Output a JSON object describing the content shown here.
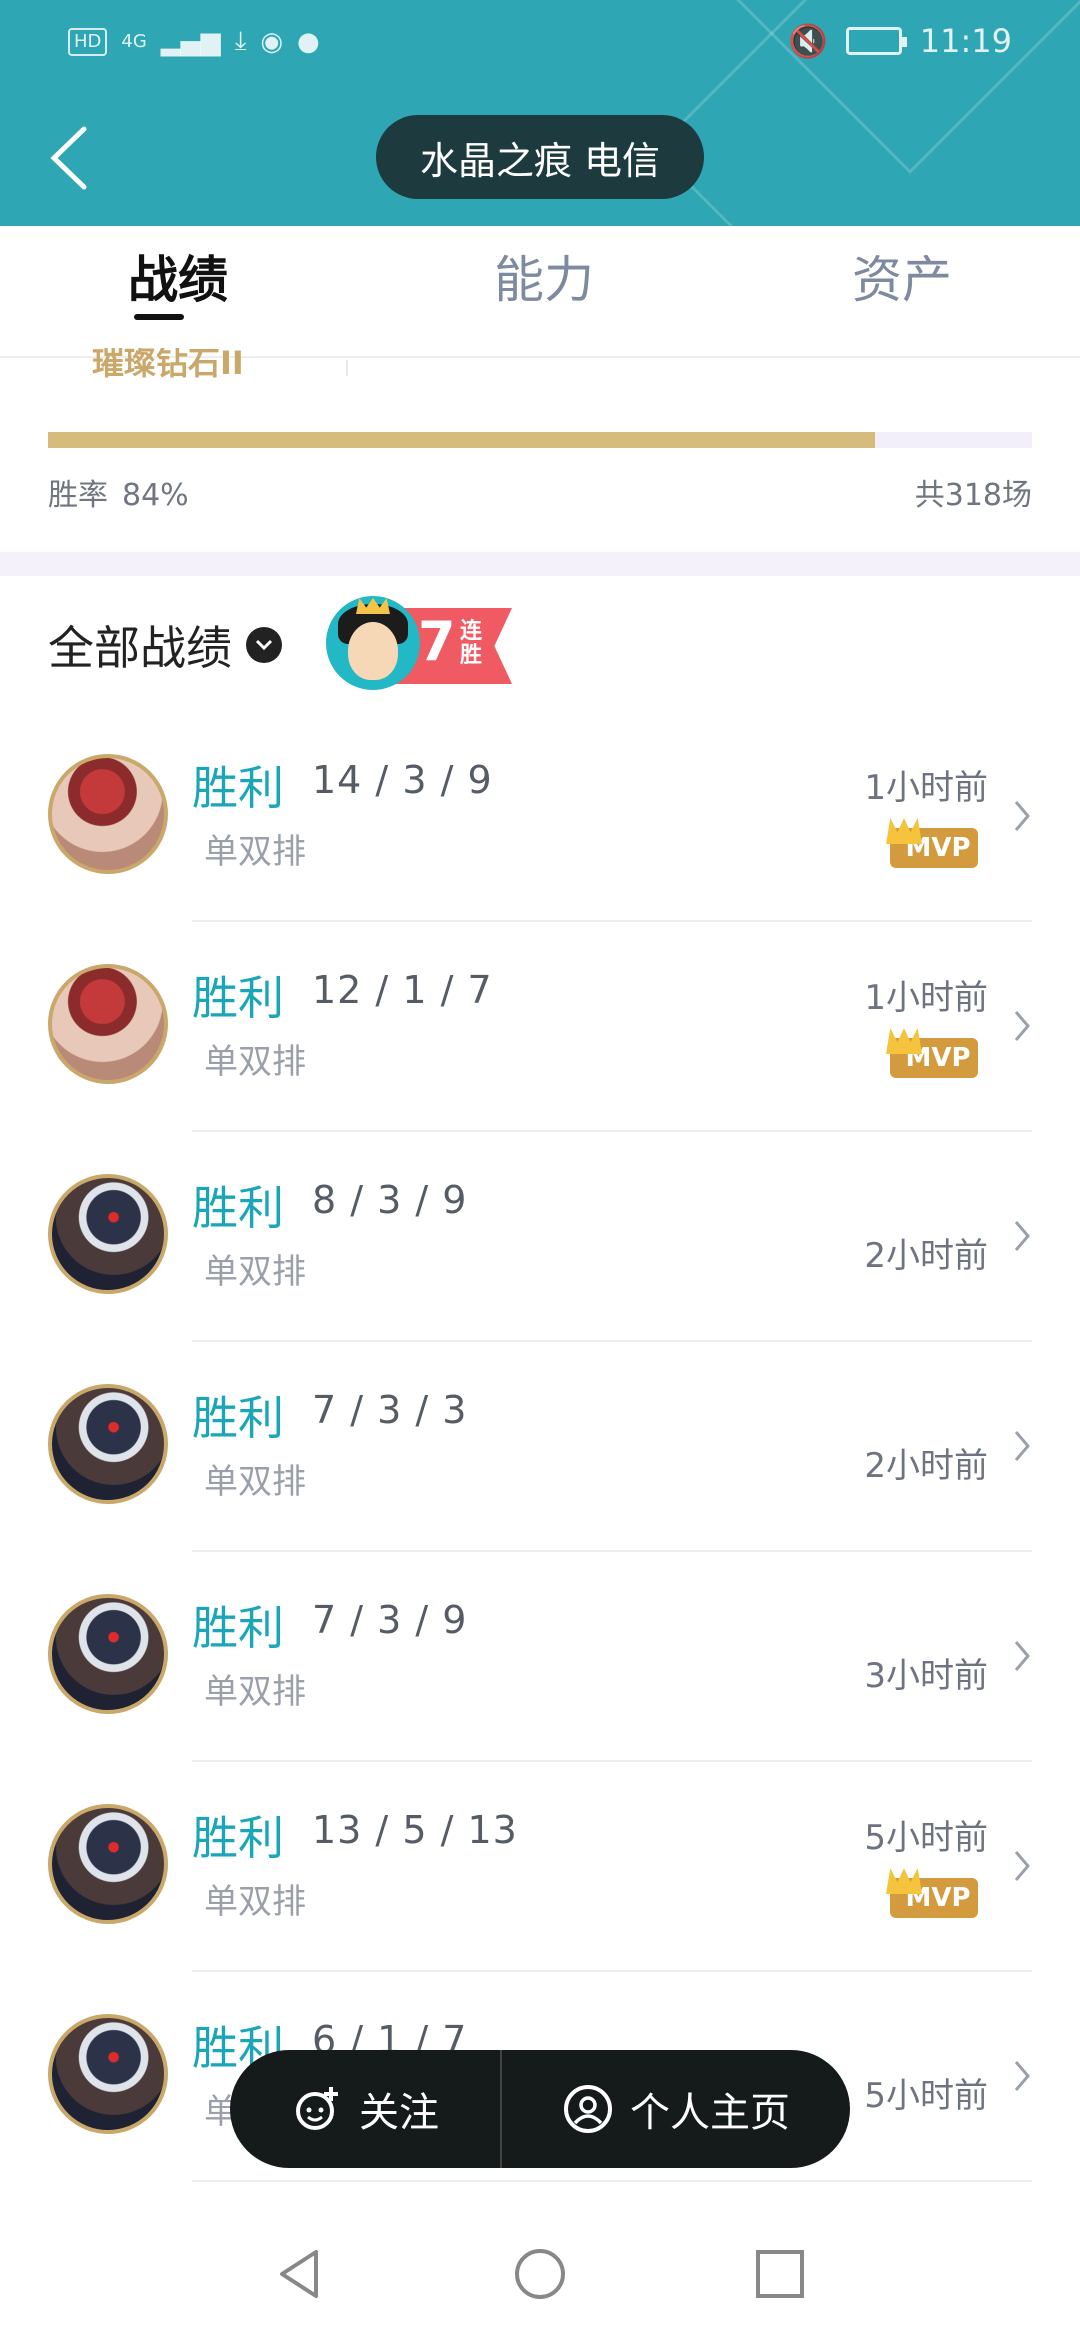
{
  "status_bar": {
    "left_items": [
      "HD",
      "4G"
    ],
    "time": "11:19"
  },
  "header": {
    "title": "水晶之痕 电信"
  },
  "tabs": [
    {
      "label": "战绩",
      "active": true
    },
    {
      "label": "能力",
      "active": false
    },
    {
      "label": "资产",
      "active": false
    }
  ],
  "rank": {
    "partial_label": "璀璨钻石II"
  },
  "stats": {
    "win_rate_label": "胜率",
    "win_rate_value": "84%",
    "win_rate_fraction": 0.84,
    "total_games": "共318场"
  },
  "filter": {
    "label": "全部战绩"
  },
  "streak": {
    "count": "7",
    "text": "连胜"
  },
  "matches": [
    {
      "result": "胜利",
      "kda": "14 / 3 / 9",
      "mode": "单双排",
      "time": "1小时前",
      "mvp": true,
      "champion": "champ-red"
    },
    {
      "result": "胜利",
      "kda": "12 / 1 / 7",
      "mode": "单双排",
      "time": "1小时前",
      "mvp": true,
      "champion": "champ-red"
    },
    {
      "result": "胜利",
      "kda": "8 / 3 / 9",
      "mode": "单双排",
      "time": "2小时前",
      "mvp": false,
      "champion": "champ-dark"
    },
    {
      "result": "胜利",
      "kda": "7 / 3 / 3",
      "mode": "单双排",
      "time": "2小时前",
      "mvp": false,
      "champion": "champ-dark"
    },
    {
      "result": "胜利",
      "kda": "7 / 3 / 9",
      "mode": "单双排",
      "time": "3小时前",
      "mvp": false,
      "champion": "champ-dark"
    },
    {
      "result": "胜利",
      "kda": "13 / 5 / 13",
      "mode": "单双排",
      "time": "5小时前",
      "mvp": true,
      "champion": "champ-dark"
    },
    {
      "result": "胜利",
      "kda": "6 / 1 / 7",
      "mode": "单双排",
      "time": "5小时前",
      "mvp": false,
      "champion": "champ-dark"
    }
  ],
  "mvp_label": "MVP",
  "actions": {
    "follow": "关注",
    "profile": "个人主页"
  },
  "colors": {
    "header_bg": "#2ea6b3",
    "win_text": "#1aa5b8",
    "win_bar": "#d6bc7c",
    "action_bar": "#151a1b"
  }
}
